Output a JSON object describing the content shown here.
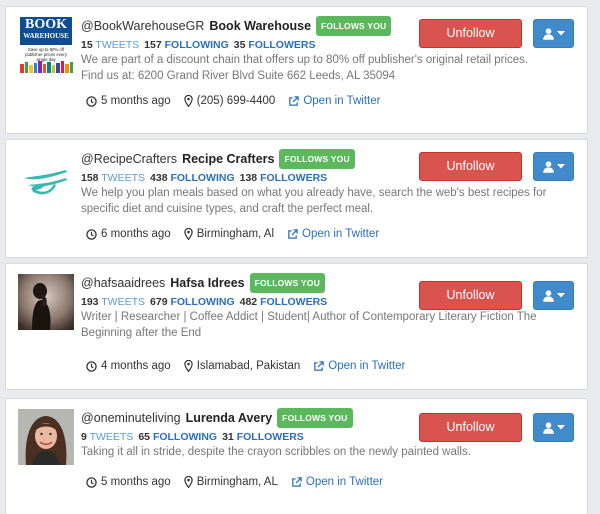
{
  "cards": [
    {
      "handle": "@BookWarehouseGR",
      "name": "Book Warehouse",
      "badge": "FOLLOWS YOU",
      "tweets_count": "15",
      "tweets_label": "TWEETS",
      "following_count": "157",
      "following_label": "FOLLOWING",
      "followers_count": "35",
      "followers_label": "FOLLOWERS",
      "bio": "We are part of a discount chain that offers up to 80% off publisher's original retail prices. Find us at: 6200 Grand River Blvd Suite 662 Leeds, AL 35094",
      "time": "5 months ago",
      "location": "(205) 699-4400",
      "link": "Open in Twitter",
      "button": "Unfollow",
      "logo_text_1": "BOOK",
      "logo_text_2": "WAREHOUSE",
      "logo_tagline": "Save up to 80% off publisher prices every single day"
    },
    {
      "handle": "@RecipeCrafters",
      "name": "Recipe Crafters",
      "badge": "FOLLOWS YOU",
      "tweets_count": "158",
      "tweets_label": "TWEETS",
      "following_count": "438",
      "following_label": "FOLLOWING",
      "followers_count": "138",
      "followers_label": "FOLLOWERS",
      "bio": "We help you plan meals based on what you already have, search the web's best recipes for specific diet and cuisine types, and craft the perfect meal.",
      "time": "6 months ago",
      "location": "Birmingham, Al",
      "link": "Open in Twitter",
      "button": "Unfollow"
    },
    {
      "handle": "@hafsaaidrees",
      "name": "Hafsa Idrees",
      "badge": "FOLLOWS YOU",
      "tweets_count": "193",
      "tweets_label": "TWEETS",
      "following_count": "679",
      "following_label": "FOLLOWING",
      "followers_count": "482",
      "followers_label": "FOLLOWERS",
      "bio": "Writer | Researcher | Coffee Addict | Student| Author of Contemporary Literary Fiction The Beginning after the End",
      "time": "4 months ago",
      "location": "Islamabad, Pakistan",
      "link": "Open in Twitter",
      "button": "Unfollow"
    },
    {
      "handle": "@oneminuteliving",
      "name": "Lurenda Avery",
      "badge": "FOLLOWS YOU",
      "tweets_count": "9",
      "tweets_label": "TWEETS",
      "following_count": "65",
      "following_label": "FOLLOWING",
      "followers_count": "31",
      "followers_label": "FOLLOWERS",
      "bio": "Taking it all in stride, despite the crayon scribbles on the newly painted walls.",
      "time": "5 months ago",
      "location": "Birmingham, AL",
      "link": "Open in Twitter",
      "button": "Unfollow"
    }
  ],
  "colors": {
    "badge": "#5cb85c",
    "unfollow": "#d9534f",
    "user_menu": "#428bca",
    "link": "#2a6fbd"
  },
  "icons": {
    "time": "clock-icon",
    "location": "map-marker-icon",
    "link": "external-link-icon",
    "menu": "user-icon",
    "caret": "caret-down-icon"
  }
}
